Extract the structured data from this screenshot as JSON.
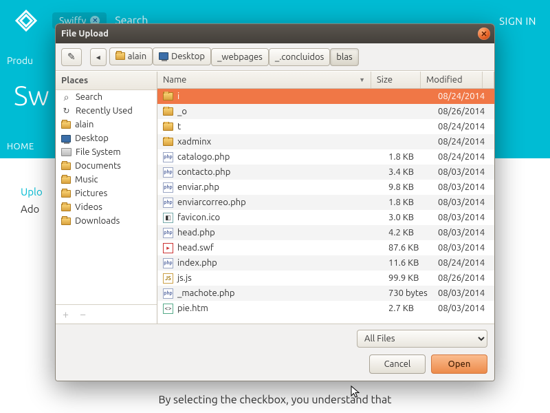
{
  "background": {
    "search_placeholder": "Search",
    "signin": "SIGN IN",
    "products": "Produ",
    "title": "Sw",
    "home": "HOME",
    "upload_label": "Uplo",
    "ado_line": "Ado",
    "footer": "By selecting the checkbox, you understand that",
    "swiffy_pill": "Swiffy"
  },
  "dialog": {
    "title": "File Upload",
    "path": [
      {
        "label": "alain",
        "icon": "folder"
      },
      {
        "label": "Desktop",
        "icon": "monitor"
      },
      {
        "label": "_webpages",
        "icon": null
      },
      {
        "label": "_.concluidos",
        "icon": null
      },
      {
        "label": "blas",
        "icon": null,
        "active": true
      }
    ],
    "places_header": "Places",
    "places": [
      {
        "label": "Search",
        "icon": "search"
      },
      {
        "label": "Recently Used",
        "icon": "recent"
      },
      {
        "label": "alain",
        "icon": "folder"
      },
      {
        "label": "Desktop",
        "icon": "monitor"
      },
      {
        "label": "File System",
        "icon": "drive"
      },
      {
        "label": "Documents",
        "icon": "folder"
      },
      {
        "label": "Music",
        "icon": "folder"
      },
      {
        "label": "Pictures",
        "icon": "folder"
      },
      {
        "label": "Videos",
        "icon": "folder"
      },
      {
        "label": "Downloads",
        "icon": "folder"
      }
    ],
    "columns": {
      "name": "Name",
      "size": "Size",
      "modified": "Modified"
    },
    "files": [
      {
        "name": "i",
        "type": "folder",
        "size": "",
        "modified": "08/24/2014",
        "selected": true
      },
      {
        "name": "_o",
        "type": "folder",
        "size": "",
        "modified": "08/26/2014"
      },
      {
        "name": "t",
        "type": "folder",
        "size": "",
        "modified": "08/24/2014"
      },
      {
        "name": "xadminx",
        "type": "folder",
        "size": "",
        "modified": "08/24/2014"
      },
      {
        "name": "catalogo.php",
        "type": "php",
        "size": "1.8 KB",
        "modified": "08/24/2014"
      },
      {
        "name": "contacto.php",
        "type": "php",
        "size": "3.4 KB",
        "modified": "08/03/2014"
      },
      {
        "name": "enviar.php",
        "type": "php",
        "size": "9.8 KB",
        "modified": "08/03/2014"
      },
      {
        "name": "enviarcorreo.php",
        "type": "php",
        "size": "1.8 KB",
        "modified": "08/03/2014"
      },
      {
        "name": "favicon.ico",
        "type": "ico",
        "size": "3.0 KB",
        "modified": "08/03/2014"
      },
      {
        "name": "head.php",
        "type": "php",
        "size": "4.2 KB",
        "modified": "08/03/2014"
      },
      {
        "name": "head.swf",
        "type": "swf",
        "size": "87.6 KB",
        "modified": "08/03/2014"
      },
      {
        "name": "index.php",
        "type": "php",
        "size": "11.6 KB",
        "modified": "08/24/2014"
      },
      {
        "name": "js.js",
        "type": "js",
        "size": "99.9 KB",
        "modified": "08/26/2014"
      },
      {
        "name": "_machote.php",
        "type": "php",
        "size": "730 bytes",
        "modified": "08/03/2014"
      },
      {
        "name": "pie.htm",
        "type": "htm",
        "size": "2.7 KB",
        "modified": "08/03/2014"
      }
    ],
    "filter": "All Files",
    "cancel": "Cancel",
    "open": "Open"
  }
}
